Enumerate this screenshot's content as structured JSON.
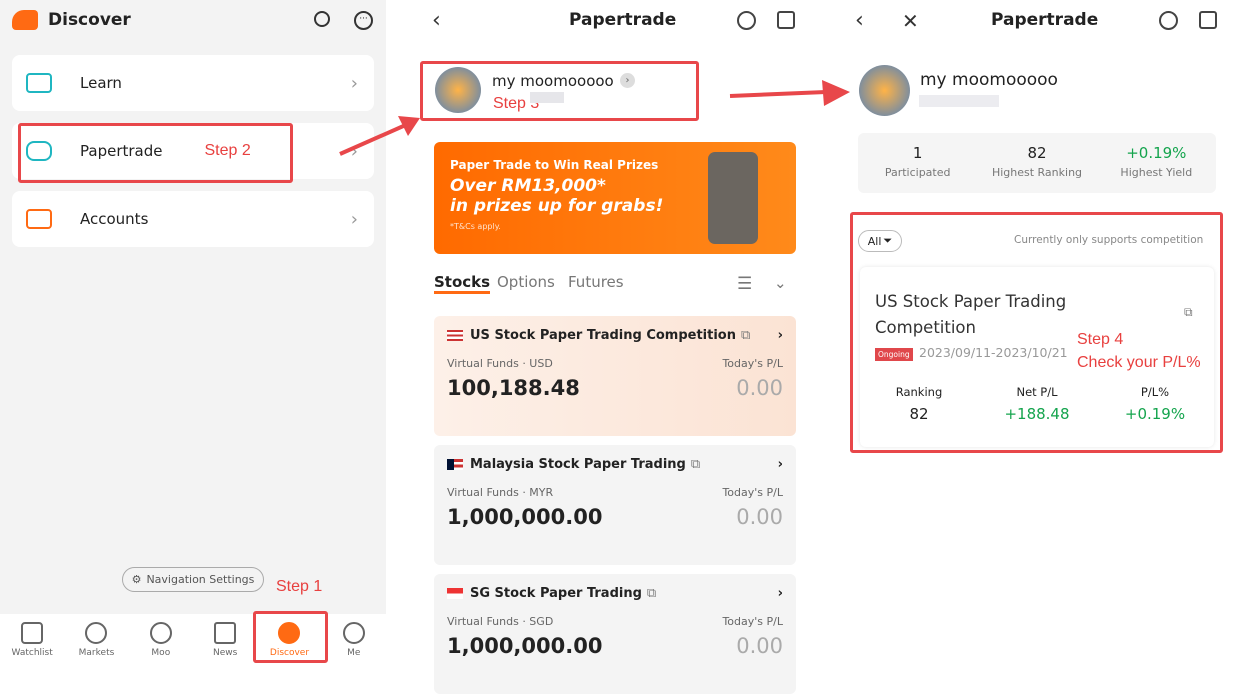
{
  "panel1": {
    "title": "Discover",
    "menu": [
      {
        "label": "Learn"
      },
      {
        "label": "Papertrade"
      },
      {
        "label": "Accounts"
      }
    ],
    "nav_settings": "Navigation Settings",
    "tabs": [
      "Watchlist",
      "Markets",
      "Moo",
      "News",
      "Discover",
      "Me"
    ],
    "step1": "Step 1",
    "step2": "Step 2"
  },
  "panel2": {
    "title": "Papertrade",
    "username": "my moomooooo",
    "step3": "Step 3",
    "banner": {
      "line1": "Paper Trade to Win Real Prizes",
      "line2": "Over RM13,000*",
      "line3": "in prizes up for grabs!",
      "note": "*T&Cs apply."
    },
    "tabs": [
      "Stocks",
      "Options",
      "Futures"
    ],
    "cards": [
      {
        "name": "US Stock Paper Trading Competition",
        "funds_label": "Virtual Funds · USD",
        "pl_label": "Today's P/L",
        "funds": "100,188.48",
        "pl": "0.00"
      },
      {
        "name": "Malaysia Stock Paper Trading",
        "funds_label": "Virtual Funds · MYR",
        "pl_label": "Today's P/L",
        "funds": "1,000,000.00",
        "pl": "0.00"
      },
      {
        "name": "SG Stock Paper Trading",
        "funds_label": "Virtual Funds · SGD",
        "pl_label": "Today's P/L",
        "funds": "1,000,000.00",
        "pl": "0.00"
      }
    ]
  },
  "panel3": {
    "title": "Papertrade",
    "username": "my moomooooo",
    "stats": [
      {
        "value": "1",
        "label": "Participated"
      },
      {
        "value": "82",
        "label": "Highest Ranking"
      },
      {
        "value": "+0.19%",
        "label": "Highest Yield"
      }
    ],
    "filter": "All",
    "note": "Currently only supports competition",
    "competition": {
      "name_line1": "US Stock Paper Trading",
      "name_line2": "Competition",
      "status": "Ongoing",
      "dates": "2023/09/11-2023/10/21",
      "ranking_label": "Ranking",
      "ranking": "82",
      "netpl_label": "Net P/L",
      "netpl": "+188.48",
      "plpct_label": "P/L%",
      "plpct": "+0.19%"
    },
    "step4": "Step 4",
    "step4_note": "Check your P/L%"
  },
  "colors": {
    "brand": "#ff6a13",
    "annotation": "#e8474a",
    "gain": "#14a44d"
  }
}
